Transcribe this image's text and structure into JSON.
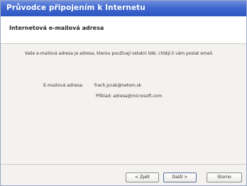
{
  "window": {
    "title": "Průvodce připojením k Internetu"
  },
  "header": {
    "title": "Internetová e-mailová adresa"
  },
  "content": {
    "description": "Vaše e-mailová adresa je adresa, kterou používají ostatní lidé, chtějí-li vám poslat email.",
    "email_label": "E-mailová adresa:",
    "email_value": "frach.jurak@netom.sk",
    "example": "Příklad: adresa@microsoft.com"
  },
  "buttons": {
    "back": "< Zpět",
    "next": "Další >",
    "cancel": "Storno"
  },
  "colors": {
    "titlebar": "#3a63cc",
    "background": "#f3f2ee",
    "header": "#ffffff"
  }
}
